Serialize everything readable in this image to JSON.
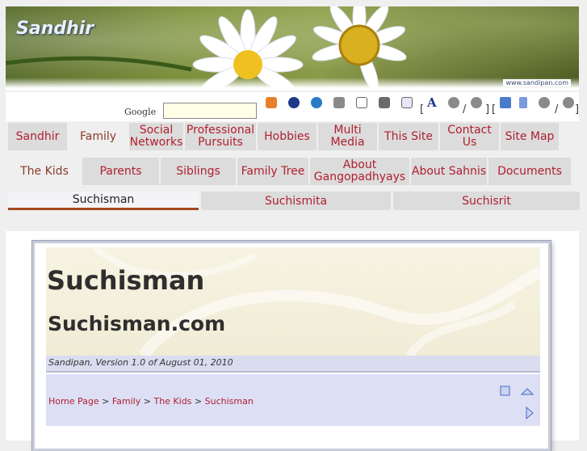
{
  "banner": {
    "logo": "Sandhir",
    "url": "www.sandipan.com"
  },
  "toolbar": {
    "google_label": "Google",
    "search_value": "",
    "bracket_open": "[",
    "bracket_close": "]",
    "slash": "/"
  },
  "nav1": [
    {
      "label": "Sandhir",
      "active": false
    },
    {
      "label": "Family",
      "active": true
    },
    {
      "label": "Social Networks",
      "active": false
    },
    {
      "label": "Professional Pursuits",
      "active": false
    },
    {
      "label": "Hobbies",
      "active": false
    },
    {
      "label": "Multi Media",
      "active": false
    },
    {
      "label": "This Site",
      "active": false
    },
    {
      "label": "Contact Us",
      "active": false
    },
    {
      "label": "Site Map",
      "active": false
    }
  ],
  "nav2": [
    {
      "label": "The Kids",
      "active": true
    },
    {
      "label": "Parents",
      "active": false
    },
    {
      "label": "Siblings",
      "active": false
    },
    {
      "label": "Family Tree",
      "active": false
    },
    {
      "label": "About Gangopadhyays",
      "active": false
    },
    {
      "label": "About Sahnis",
      "active": false
    },
    {
      "label": "Documents",
      "active": false
    }
  ],
  "nav3": [
    {
      "label": "Suchisman",
      "active": true
    },
    {
      "label": "Suchismita",
      "active": false
    },
    {
      "label": "Suchisrit",
      "active": false
    }
  ],
  "page": {
    "title": "Suchisman",
    "subtitle": "Suchisman.com",
    "version": "Sandipan, Version 1.0 of August 01, 2010",
    "breadcrumb": [
      {
        "label": "Home Page"
      },
      {
        "label": "Family"
      },
      {
        "label": "The Kids"
      },
      {
        "label": "Suchisman"
      }
    ],
    "breadcrumb_sep": ">"
  },
  "colors": {
    "link": "#b02030",
    "tab_bg": "#dcdcdc",
    "active_underline": "#a64820"
  }
}
